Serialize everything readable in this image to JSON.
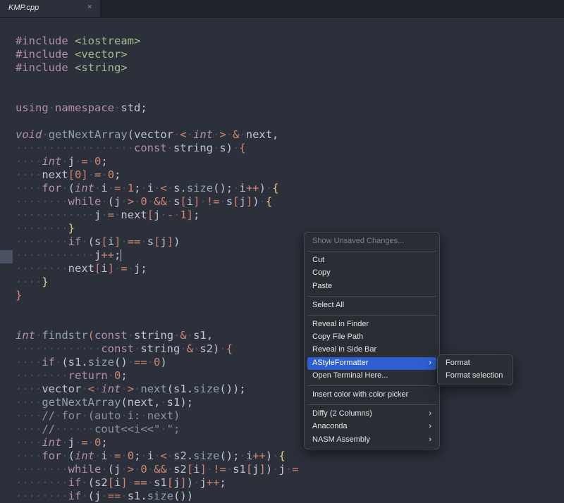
{
  "tab": {
    "title": "KMP.cpp",
    "close_symbol": "×"
  },
  "code_lines": [
    [
      [
        "pp",
        "#include "
      ],
      [
        "str",
        "<iostream>"
      ]
    ],
    [
      [
        "pp",
        "#include "
      ],
      [
        "str",
        "<vector>"
      ]
    ],
    [
      [
        "pp",
        "#include "
      ],
      [
        "str",
        "<string>"
      ]
    ],
    [],
    [],
    [
      [
        "kw",
        "using"
      ],
      [
        "ws",
        "·"
      ],
      [
        "kw",
        "namespace"
      ],
      [
        "ws",
        "·"
      ],
      [
        "pl",
        "std;"
      ]
    ],
    [],
    [
      [
        "ty",
        "void"
      ],
      [
        "ws",
        "·"
      ],
      [
        "fn",
        "getNextArray"
      ],
      [
        "pl",
        "(vector"
      ],
      [
        "ws",
        "·"
      ],
      [
        "op",
        "<"
      ],
      [
        "ws",
        "·"
      ],
      [
        "ty",
        "int"
      ],
      [
        "ws",
        "·"
      ],
      [
        "op",
        ">"
      ],
      [
        "ws",
        "·"
      ],
      [
        "op",
        "&"
      ],
      [
        "ws",
        "·"
      ],
      [
        "pl",
        "next,"
      ]
    ],
    [
      [
        "ws",
        "··················"
      ],
      [
        "kw",
        "const"
      ],
      [
        "ws",
        "·"
      ],
      [
        "pl",
        "string"
      ],
      [
        "ws",
        "·"
      ],
      [
        "pl",
        "s)"
      ],
      [
        "ws",
        "·"
      ],
      [
        "op",
        "{"
      ]
    ],
    [
      [
        "ws",
        "····"
      ],
      [
        "ty",
        "int"
      ],
      [
        "ws",
        "·"
      ],
      [
        "pl",
        "j"
      ],
      [
        "ws",
        "·"
      ],
      [
        "op",
        "="
      ],
      [
        "ws",
        "·"
      ],
      [
        "num",
        "0"
      ],
      [
        "pl",
        ";"
      ]
    ],
    [
      [
        "ws",
        "····"
      ],
      [
        "pl",
        "next"
      ],
      [
        "op",
        "["
      ],
      [
        "num",
        "0"
      ],
      [
        "op",
        "]"
      ],
      [
        "ws",
        "·"
      ],
      [
        "op",
        "="
      ],
      [
        "ws",
        "·"
      ],
      [
        "num",
        "0"
      ],
      [
        "pl",
        ";"
      ]
    ],
    [
      [
        "ws",
        "····"
      ],
      [
        "kw",
        "for"
      ],
      [
        "ws",
        "·"
      ],
      [
        "pl",
        "("
      ],
      [
        "ty",
        "int"
      ],
      [
        "ws",
        "·"
      ],
      [
        "pl",
        "i"
      ],
      [
        "ws",
        "·"
      ],
      [
        "op",
        "="
      ],
      [
        "ws",
        "·"
      ],
      [
        "num",
        "1"
      ],
      [
        "pl",
        ";"
      ],
      [
        "ws",
        "·"
      ],
      [
        "pl",
        "i"
      ],
      [
        "ws",
        "·"
      ],
      [
        "op",
        "<"
      ],
      [
        "ws",
        "·"
      ],
      [
        "pl",
        "s."
      ],
      [
        "fn",
        "size"
      ],
      [
        "pl",
        "();"
      ],
      [
        "ws",
        "·"
      ],
      [
        "pl",
        "i"
      ],
      [
        "op",
        "++"
      ],
      [
        "pl",
        ")"
      ],
      [
        "ws",
        "·"
      ],
      [
        "br",
        "{"
      ]
    ],
    [
      [
        "ws",
        "········"
      ],
      [
        "kw",
        "while"
      ],
      [
        "ws",
        "·"
      ],
      [
        "pl",
        "(j"
      ],
      [
        "ws",
        "·"
      ],
      [
        "op",
        ">"
      ],
      [
        "ws",
        "·"
      ],
      [
        "num",
        "0"
      ],
      [
        "ws",
        "·"
      ],
      [
        "op",
        "&&"
      ],
      [
        "ws",
        "·"
      ],
      [
        "pl",
        "s"
      ],
      [
        "op",
        "["
      ],
      [
        "pl",
        "i"
      ],
      [
        "op",
        "]"
      ],
      [
        "ws",
        "·"
      ],
      [
        "op",
        "!="
      ],
      [
        "ws",
        "·"
      ],
      [
        "pl",
        "s"
      ],
      [
        "op",
        "["
      ],
      [
        "pl",
        "j"
      ],
      [
        "op",
        "]"
      ],
      [
        "pl",
        ")"
      ],
      [
        "ws",
        "·"
      ],
      [
        "br",
        "{"
      ]
    ],
    [
      [
        "ws",
        "············"
      ],
      [
        "pl",
        "j"
      ],
      [
        "ws",
        "·"
      ],
      [
        "op",
        "="
      ],
      [
        "ws",
        "·"
      ],
      [
        "pl",
        "next"
      ],
      [
        "op",
        "["
      ],
      [
        "pl",
        "j"
      ],
      [
        "ws",
        "·"
      ],
      [
        "op",
        "-"
      ],
      [
        "ws",
        "·"
      ],
      [
        "num",
        "1"
      ],
      [
        "op",
        "]"
      ],
      [
        "pl",
        ";"
      ]
    ],
    [
      [
        "ws",
        "········"
      ],
      [
        "br",
        "}"
      ]
    ],
    [
      [
        "ws",
        "········"
      ],
      [
        "kw",
        "if"
      ],
      [
        "ws",
        "·"
      ],
      [
        "pl",
        "(s"
      ],
      [
        "op",
        "["
      ],
      [
        "pl",
        "i"
      ],
      [
        "op",
        "]"
      ],
      [
        "ws",
        "·"
      ],
      [
        "op",
        "=="
      ],
      [
        "ws",
        "·"
      ],
      [
        "pl",
        "s"
      ],
      [
        "op",
        "["
      ],
      [
        "pl",
        "j"
      ],
      [
        "op",
        "]"
      ],
      [
        "pl",
        ")"
      ]
    ],
    [
      [
        "ws",
        "············"
      ],
      [
        "pl",
        "j"
      ],
      [
        "op",
        "++"
      ],
      [
        "pl",
        ";"
      ],
      [
        "cur",
        ""
      ]
    ],
    [
      [
        "ws",
        "········"
      ],
      [
        "pl",
        "next"
      ],
      [
        "op",
        "["
      ],
      [
        "pl",
        "i"
      ],
      [
        "op",
        "]"
      ],
      [
        "ws",
        "·"
      ],
      [
        "op",
        "="
      ],
      [
        "ws",
        "·"
      ],
      [
        "pl",
        "j;"
      ]
    ],
    [
      [
        "ws",
        "····"
      ],
      [
        "br",
        "}"
      ]
    ],
    [
      [
        "op",
        "}"
      ]
    ],
    [],
    [],
    [
      [
        "ty",
        "int"
      ],
      [
        "ws",
        "·"
      ],
      [
        "fn",
        "findstr"
      ],
      [
        "op",
        "("
      ],
      [
        "kw",
        "const"
      ],
      [
        "ws",
        "·"
      ],
      [
        "pl",
        "string"
      ],
      [
        "ws",
        "·"
      ],
      [
        "op",
        "&"
      ],
      [
        "ws",
        "·"
      ],
      [
        "pl",
        "s1,"
      ]
    ],
    [
      [
        "ws",
        "·············"
      ],
      [
        "kw",
        "const"
      ],
      [
        "ws",
        "·"
      ],
      [
        "pl",
        "string"
      ],
      [
        "ws",
        "·"
      ],
      [
        "op",
        "&"
      ],
      [
        "ws",
        "·"
      ],
      [
        "pl",
        "s2)"
      ],
      [
        "ws",
        "·"
      ],
      [
        "op",
        "{"
      ]
    ],
    [
      [
        "ws",
        "····"
      ],
      [
        "kw",
        "if"
      ],
      [
        "ws",
        "·"
      ],
      [
        "pl",
        "(s1."
      ],
      [
        "fn",
        "size"
      ],
      [
        "pl",
        "()"
      ],
      [
        "ws",
        "·"
      ],
      [
        "op",
        "=="
      ],
      [
        "ws",
        "·"
      ],
      [
        "num",
        "0"
      ],
      [
        "pl",
        ")"
      ]
    ],
    [
      [
        "ws",
        "········"
      ],
      [
        "kw",
        "return"
      ],
      [
        "ws",
        "·"
      ],
      [
        "num",
        "0"
      ],
      [
        "pl",
        ";"
      ]
    ],
    [
      [
        "ws",
        "····"
      ],
      [
        "pl",
        "vector"
      ],
      [
        "ws",
        "·"
      ],
      [
        "op",
        "<"
      ],
      [
        "ws",
        "·"
      ],
      [
        "ty",
        "int"
      ],
      [
        "ws",
        "·"
      ],
      [
        "op",
        ">"
      ],
      [
        "ws",
        "·"
      ],
      [
        "fn",
        "next"
      ],
      [
        "pl",
        "(s1."
      ],
      [
        "fn",
        "size"
      ],
      [
        "pl",
        "());"
      ]
    ],
    [
      [
        "ws",
        "····"
      ],
      [
        "fn",
        "getNextArray"
      ],
      [
        "pl",
        "(next,"
      ],
      [
        "ws",
        "·"
      ],
      [
        "pl",
        "s1);"
      ]
    ],
    [
      [
        "ws",
        "····"
      ],
      [
        "cm",
        "//"
      ],
      [
        "ws",
        "·"
      ],
      [
        "cm",
        "for"
      ],
      [
        "ws",
        "·"
      ],
      [
        "cm",
        "(auto"
      ],
      [
        "ws",
        "·"
      ],
      [
        "cm",
        "i:"
      ],
      [
        "ws",
        "·"
      ],
      [
        "cm",
        "next)"
      ]
    ],
    [
      [
        "ws",
        "····"
      ],
      [
        "cm",
        "//"
      ],
      [
        "ws",
        "······"
      ],
      [
        "cm",
        "cout<<i<<\""
      ],
      [
        "ws",
        "·"
      ],
      [
        "cm",
        "\";"
      ]
    ],
    [
      [
        "ws",
        "····"
      ],
      [
        "ty",
        "int"
      ],
      [
        "ws",
        "·"
      ],
      [
        "pl",
        "j"
      ],
      [
        "ws",
        "·"
      ],
      [
        "op",
        "="
      ],
      [
        "ws",
        "·"
      ],
      [
        "num",
        "0"
      ],
      [
        "pl",
        ";"
      ]
    ],
    [
      [
        "ws",
        "····"
      ],
      [
        "kw",
        "for"
      ],
      [
        "ws",
        "·"
      ],
      [
        "pl",
        "("
      ],
      [
        "ty",
        "int"
      ],
      [
        "ws",
        "·"
      ],
      [
        "pl",
        "i"
      ],
      [
        "ws",
        "·"
      ],
      [
        "op",
        "="
      ],
      [
        "ws",
        "·"
      ],
      [
        "num",
        "0"
      ],
      [
        "pl",
        ";"
      ],
      [
        "ws",
        "·"
      ],
      [
        "pl",
        "i"
      ],
      [
        "ws",
        "·"
      ],
      [
        "op",
        "<"
      ],
      [
        "ws",
        "·"
      ],
      [
        "pl",
        "s2."
      ],
      [
        "fn",
        "size"
      ],
      [
        "pl",
        "();"
      ],
      [
        "ws",
        "·"
      ],
      [
        "pl",
        "i"
      ],
      [
        "op",
        "++"
      ],
      [
        "pl",
        ")"
      ],
      [
        "ws",
        "·"
      ],
      [
        "br",
        "{"
      ]
    ],
    [
      [
        "ws",
        "········"
      ],
      [
        "kw",
        "while"
      ],
      [
        "ws",
        "·"
      ],
      [
        "pl",
        "(j"
      ],
      [
        "ws",
        "·"
      ],
      [
        "op",
        ">"
      ],
      [
        "ws",
        "·"
      ],
      [
        "num",
        "0"
      ],
      [
        "ws",
        "·"
      ],
      [
        "op",
        "&&"
      ],
      [
        "ws",
        "·"
      ],
      [
        "pl",
        "s2"
      ],
      [
        "op",
        "["
      ],
      [
        "pl",
        "i"
      ],
      [
        "op",
        "]"
      ],
      [
        "ws",
        "·"
      ],
      [
        "op",
        "!="
      ],
      [
        "ws",
        "·"
      ],
      [
        "pl",
        "s1"
      ],
      [
        "op",
        "["
      ],
      [
        "pl",
        "j"
      ],
      [
        "op",
        "]"
      ],
      [
        "pl",
        ")"
      ],
      [
        "ws",
        "·"
      ],
      [
        "pl",
        "j"
      ],
      [
        "ws",
        "·"
      ],
      [
        "op",
        "="
      ]
    ],
    [
      [
        "ws",
        "········"
      ],
      [
        "kw",
        "if"
      ],
      [
        "ws",
        "·"
      ],
      [
        "pl",
        "(s2"
      ],
      [
        "op",
        "["
      ],
      [
        "pl",
        "i"
      ],
      [
        "op",
        "]"
      ],
      [
        "ws",
        "·"
      ],
      [
        "op",
        "=="
      ],
      [
        "ws",
        "·"
      ],
      [
        "pl",
        "s1"
      ],
      [
        "op",
        "["
      ],
      [
        "pl",
        "j"
      ],
      [
        "op",
        "]"
      ],
      [
        "pl",
        ")"
      ],
      [
        "ws",
        "·"
      ],
      [
        "pl",
        "j"
      ],
      [
        "op",
        "++"
      ],
      [
        "pl",
        ";"
      ]
    ],
    [
      [
        "ws",
        "········"
      ],
      [
        "kw",
        "if"
      ],
      [
        "ws",
        "·"
      ],
      [
        "pl",
        "(j"
      ],
      [
        "ws",
        "·"
      ],
      [
        "op",
        "=="
      ],
      [
        "ws",
        "·"
      ],
      [
        "pl",
        "s1."
      ],
      [
        "fn",
        "size"
      ],
      [
        "pl",
        "())"
      ]
    ]
  ],
  "context_menu": {
    "items": [
      {
        "label": "Show Unsaved Changes...",
        "disabled": true
      },
      {
        "sep": true
      },
      {
        "label": "Cut"
      },
      {
        "label": "Copy"
      },
      {
        "label": "Paste"
      },
      {
        "sep": true
      },
      {
        "label": "Select All"
      },
      {
        "sep": true
      },
      {
        "label": "Reveal in Finder"
      },
      {
        "label": "Copy File Path"
      },
      {
        "label": "Reveal in Side Bar"
      },
      {
        "label": "AStyleFormatter",
        "submenu": true,
        "active": true
      },
      {
        "label": "Open Terminal Here..."
      },
      {
        "sep": true
      },
      {
        "label": "Insert color with color picker"
      },
      {
        "sep": true
      },
      {
        "label": "Diffy (2 Columns)",
        "submenu": true
      },
      {
        "label": "Anaconda",
        "submenu": true
      },
      {
        "label": "NASM Assembly",
        "submenu": true
      }
    ],
    "submenu_arrow": "›"
  },
  "submenu": {
    "items": [
      {
        "label": "Format"
      },
      {
        "label": "Format selection"
      }
    ]
  },
  "colors": {
    "editor_bg": "#2b303b",
    "menu_bg": "#2a2d33",
    "menu_highlight": "#2e5fd0"
  }
}
